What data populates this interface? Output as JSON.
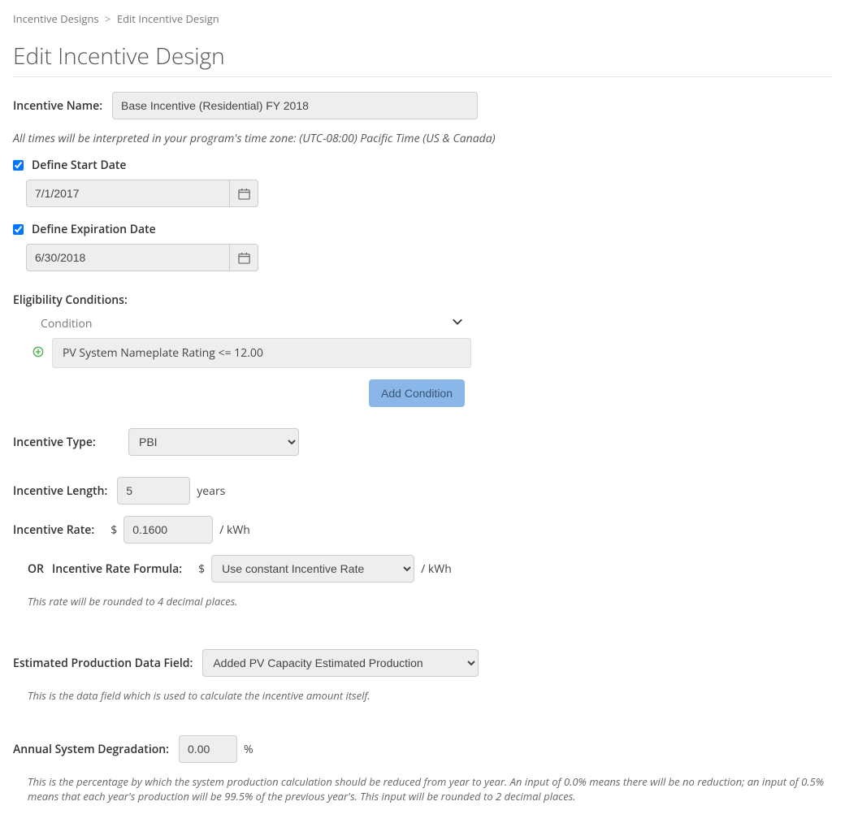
{
  "breadcrumb": {
    "root": "Incentive Designs",
    "current": "Edit Incentive Design"
  },
  "page_title": "Edit Incentive Design",
  "name_label": "Incentive Name:",
  "name_value": "Base Incentive (Residential) FY 2018",
  "tz_note": "All times will be interpreted in your program's time zone: (UTC-08:00) Pacific Time (US & Canada)",
  "start": {
    "label": "Define Start Date",
    "value": "7/1/2017"
  },
  "end": {
    "label": "Define Expiration Date",
    "value": "6/30/2018"
  },
  "conditions": {
    "label": "Eligibility Conditions:",
    "header": "Condition",
    "items": [
      "PV System Nameplate Rating <= 12.00"
    ],
    "add_btn": "Add Condition"
  },
  "type": {
    "label": "Incentive Type:",
    "value": "PBI"
  },
  "length": {
    "label": "Incentive Length:",
    "value": "5",
    "unit": "years"
  },
  "rate": {
    "label": "Incentive Rate:",
    "prefix": "$",
    "value": "0.1600",
    "suffix": "/ kWh"
  },
  "formula": {
    "or": "OR",
    "label": "Incentive Rate Formula:",
    "prefix": "$",
    "value": "Use constant Incentive Rate",
    "suffix": "/ kWh",
    "note": "This rate will be rounded to 4 decimal places."
  },
  "prodfield": {
    "label": "Estimated Production Data Field:",
    "value": "Added PV Capacity Estimated Production",
    "note": "This is the data field which is used to calculate the incentive amount itself."
  },
  "degradation": {
    "label": "Annual System Degradation:",
    "value": "0.00",
    "unit": "%",
    "note": "This is the percentage by which the system production calculation should be reduced from year to year. An input of 0.0% means there will be no reduction; an input of 0.5% means that each year's production will be 99.5% of the previous year's. This input will be rounded to 2 decimal places."
  }
}
